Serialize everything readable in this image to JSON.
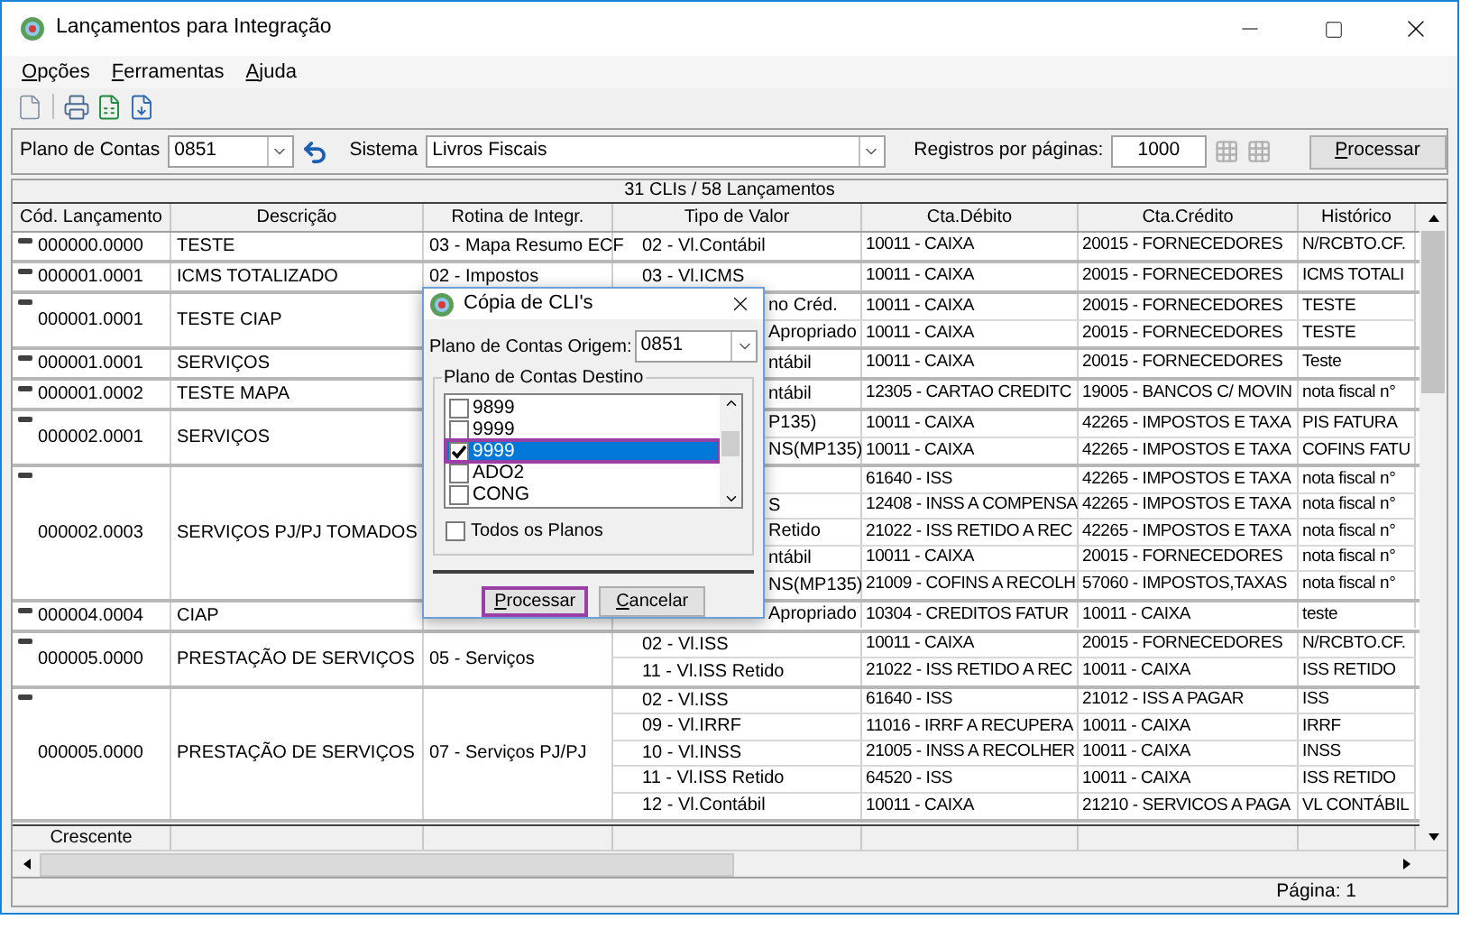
{
  "window": {
    "title": "Lançamentos para Integração"
  },
  "menu": [
    "Opções",
    "Ferramentas",
    "Ajuda"
  ],
  "filters": {
    "plan_label": "Plano de Contas",
    "plan_value": "0851",
    "system_label": "Sistema",
    "system_value": "Livros Fiscais",
    "records_label": "Registros por páginas:",
    "records_value": "1000",
    "process_button": "Processar"
  },
  "summary": "31 CLIs / 58 Lançamentos",
  "table": {
    "columns": [
      "Cód. Lançamento",
      "Descrição",
      "Rotina de Integr.",
      "Tipo de Valor",
      "Cta.Débito",
      "Cta.Crédito",
      "Histórico"
    ],
    "rows": [
      {
        "code": "000000.0000",
        "description": "TESTE",
        "routine": "03 - Mapa Resumo ECF",
        "entries": [
          {
            "type": "02 - Vl.Contábil",
            "debit": "10011 - CAIXA",
            "credit": "20015 - FORNECEDORES",
            "history": "N/RCBTO.CF.",
            "clipped": false
          }
        ]
      },
      {
        "code": "000001.0001",
        "description": "ICMS TOTALIZADO",
        "routine": "02 - Impostos",
        "entries": [
          {
            "type": "03 - Vl.ICMS",
            "debit": "10011 - CAIXA",
            "credit": "20015 - FORNECEDORES",
            "history": "ICMS TOTALI",
            "clipped": false
          }
        ]
      },
      {
        "code": "000001.0001",
        "description": "TESTE CIAP",
        "entries": [
          {
            "type": "no Créd.",
            "debit": "10011 - CAIXA",
            "credit": "20015 - FORNECEDORES",
            "history": "TESTE",
            "clipped": true
          },
          {
            "type": "Apropriado",
            "debit": "10011 - CAIXA",
            "credit": "20015 - FORNECEDORES",
            "history": "TESTE",
            "clipped": true
          }
        ]
      },
      {
        "code": "000001.0001",
        "description": "SERVIÇOS",
        "entries": [
          {
            "type": "ntábil",
            "debit": "10011 - CAIXA",
            "credit": "20015 - FORNECEDORES",
            "history": "Teste",
            "clipped": true
          }
        ]
      },
      {
        "code": "000001.0002",
        "description": "TESTE MAPA",
        "entries": [
          {
            "type": "ntábil",
            "debit": "12305 - CARTAO CREDITC",
            "credit": "19005 - BANCOS C/ MOVIN",
            "history": "nota fiscal n°",
            "clipped": true
          }
        ]
      },
      {
        "code": "000002.0001",
        "description": "SERVIÇOS",
        "entries": [
          {
            "type": "P135)",
            "debit": "10011 - CAIXA",
            "credit": "42265 - IMPOSTOS E TAXA",
            "history": "PIS FATURA",
            "clipped": true
          },
          {
            "type": "NS(MP135)",
            "debit": "10011 - CAIXA",
            "credit": "42265 - IMPOSTOS E TAXA",
            "history": "COFINS FATU",
            "clipped": true
          }
        ]
      },
      {
        "code": "000002.0003",
        "description": "SERVIÇOS PJ/PJ TOMADOS",
        "entries": [
          {
            "debit": "61640 - ISS",
            "credit": "42265 - IMPOSTOS E TAXA",
            "history": "nota fiscal n°"
          },
          {
            "type": "S",
            "debit": "12408 - INSS A COMPENSA",
            "credit": "42265 - IMPOSTOS E TAXA",
            "history": "nota fiscal n°",
            "clipped": true
          },
          {
            "type": "Retido",
            "debit": "21022 - ISS RETIDO A REC",
            "credit": "42265 - IMPOSTOS E TAXA",
            "history": "nota fiscal n°",
            "clipped": true
          },
          {
            "type": "ntábil",
            "debit": "10011 - CAIXA",
            "credit": "20015 - FORNECEDORES",
            "history": "nota fiscal n°",
            "clipped": true
          },
          {
            "type": "NS(MP135)",
            "debit": "21009 - COFINS A RECOLH",
            "credit": "57060 - IMPOSTOS,TAXAS",
            "history": "nota fiscal n°",
            "clipped": true
          }
        ]
      },
      {
        "code": "000004.0004",
        "description": "CIAP",
        "entries": [
          {
            "type": "Apropriado",
            "debit": "10304 - CREDITOS FATUR",
            "credit": "10011 - CAIXA",
            "history": "teste",
            "clipped": true
          }
        ]
      },
      {
        "code": "000005.0000",
        "description": "PRESTAÇÃO DE SERVIÇOS",
        "routine": "05 - Serviços",
        "entries": [
          {
            "type": "02 - Vl.ISS",
            "debit": "10011 - CAIXA",
            "credit": "20015 - FORNECEDORES",
            "history": "N/RCBTO.CF.",
            "clipped": false
          },
          {
            "type": "11 - Vl.ISS Retido",
            "debit": "21022 - ISS RETIDO A REC",
            "credit": "10011 - CAIXA",
            "history": "ISS RETIDO",
            "clipped": false
          }
        ]
      },
      {
        "code": "000005.0000",
        "description": "PRESTAÇÃO DE SERVIÇOS",
        "routine": "07 - Serviços PJ/PJ",
        "entries": [
          {
            "type": "02 - Vl.ISS",
            "debit": "61640 - ISS",
            "credit": "21012 - ISS A PAGAR",
            "history": "ISS",
            "clipped": false
          },
          {
            "type": "09 - Vl.IRRF",
            "debit": "11016 - IRRF A RECUPERA",
            "credit": "10011 - CAIXA",
            "history": "IRRF",
            "clipped": false
          },
          {
            "type": "10 - Vl.INSS",
            "debit": "21005 - INSS A RECOLHER",
            "credit": "10011 - CAIXA",
            "history": "INSS",
            "clipped": false
          },
          {
            "type": "11 - Vl.ISS Retido",
            "debit": "64520 - ISS",
            "credit": "10011 - CAIXA",
            "history": "ISS RETIDO",
            "clipped": false
          },
          {
            "type": "12 - Vl.Contábil",
            "debit": "10011 - CAIXA",
            "credit": "21210 - SERVICOS A PAGA",
            "history": "VL CONTÁBIL",
            "clipped": false
          }
        ]
      }
    ],
    "footer": "Crescente"
  },
  "status_bar": {
    "page": "Página: 1"
  },
  "dialog": {
    "title": "Cópia de CLI's",
    "origin_label": "Plano de Contas Origem:",
    "origin_value": "0851",
    "group_label": "Plano de Contas Destino",
    "items": [
      {
        "label": "9899",
        "checked": false,
        "selected": false
      },
      {
        "label": "9999",
        "checked": false,
        "selected": false
      },
      {
        "label": "9999",
        "checked": true,
        "selected": true
      },
      {
        "label": "ADO2",
        "checked": false,
        "selected": false
      },
      {
        "label": "CONG",
        "checked": false,
        "selected": false
      }
    ],
    "all_label": "Todos os Planos",
    "all_checked": false,
    "buttons": [
      {
        "label": "Processar",
        "focused": true
      },
      {
        "label": "Cancelar",
        "focused": false
      }
    ]
  }
}
